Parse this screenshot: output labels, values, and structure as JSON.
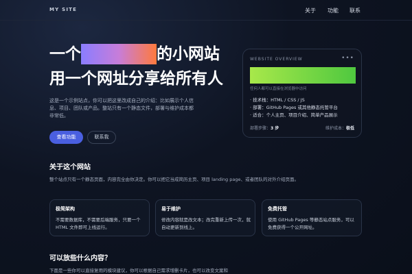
{
  "nav": {
    "logo": "MY SITE",
    "links": [
      "关于",
      "功能",
      "联系"
    ]
  },
  "hero": {
    "line1_prefix": "一个",
    "line1_suffix": "的小网站",
    "line2": "用一个网址分享给所有人",
    "intro": "这是一个示例站点，你可以把这里改成自己的介绍：比如展示个人信息、项目、团队或产品。整站只有一个静态文件，部署与维护成本都非常低。",
    "primary_button": "查看功能",
    "secondary_button": "联系我"
  },
  "overview": {
    "heading": "WEBSITE OVERVIEW",
    "dots": "•••",
    "caption": "任何人都可以直接在浏览器中访问",
    "bullets": [
      "· 技术栈：HTML / CSS / JS",
      "· 部署：GitHub Pages 或其他静态托管平台",
      "· 适合：个人主页、项目介绍、简单产品展示"
    ],
    "steps_label": "部署步骤：",
    "steps_value": "3 步",
    "cost_label": "维护成本：",
    "cost_value": "极低"
  },
  "about": {
    "title": "关于这个网站",
    "text": "整个站点只有一个静态页面，内容完全由你决定。你可以把它当成简历主页、项目 landing page、或者团队的对外介绍页面。"
  },
  "features": [
    {
      "title": "极简架构",
      "desc": "不需要数据库，不需要后端服务，只要一个 HTML 文件即可上线运行。"
    },
    {
      "title": "易于维护",
      "desc": "修改内容就是改文本；改完重新上传一次，就自动更新到线上。"
    },
    {
      "title": "免费托管",
      "desc": "使用 GitHub Pages 等静态站点服务，可以免费获得一个公开网址。"
    }
  ],
  "content": {
    "title": "可以放些什么内容？",
    "text": "下面是一些你可以直接复用的模块建议，你可以根据自己需求增删卡片，也可以改变文案和"
  }
}
